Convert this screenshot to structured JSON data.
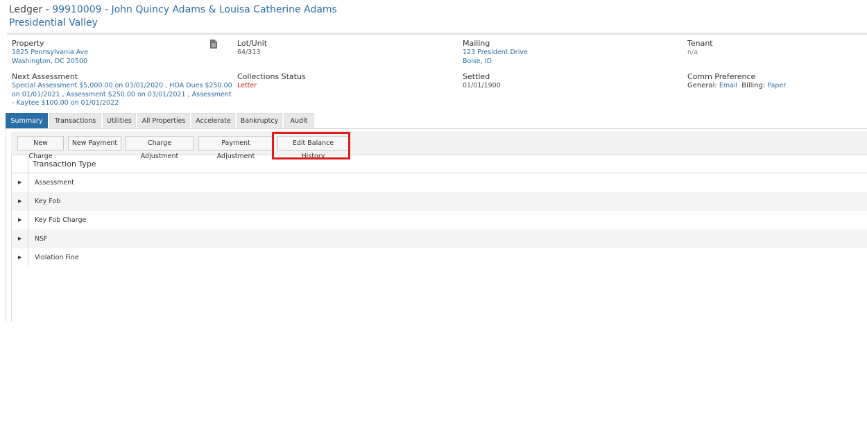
{
  "header": {
    "prefix": "Ledger - ",
    "account": "99910009 - John Quincy Adams & Louisa Catherine Adams",
    "community": "Presidential Valley"
  },
  "info": {
    "property": {
      "label": "Property",
      "line1": "1825 Pennsylvania Ave",
      "line2": "Washington, DC 20500"
    },
    "lot": {
      "label": "Lot/Unit",
      "value": "64/313"
    },
    "mailing": {
      "label": "Mailing",
      "line1": "123 President Drive",
      "line2": "Boise, ID"
    },
    "tenant": {
      "label": "Tenant",
      "value": "n/a"
    },
    "next_assessment": {
      "label": "Next Assessment",
      "line1": "Special Assessment $5,000.00 on 03/01/2020 , HOA Dues $250.00",
      "line2": "on 01/01/2021 , Assessment $250.00 on 03/01/2021 , Assessment",
      "line3": "- Kaytee $100.00 on 01/01/2022"
    },
    "collections": {
      "label": "Collections Status",
      "value": "Letter"
    },
    "settled": {
      "label": "Settled",
      "value": "01/01/1900"
    },
    "comm": {
      "label": "Comm Preference",
      "general_label": "General:",
      "general_value": "Email",
      "billing_label": "Billing:",
      "billing_value": "Paper"
    }
  },
  "tabs": [
    "Summary",
    "Transactions",
    "Utilities",
    "All Properties",
    "Accelerate",
    "Bankruptcy",
    "Audit"
  ],
  "toolbar": {
    "new_charge": "New Charge",
    "new_payment": "New Payment",
    "charge_adjustment": "Charge Adjustment",
    "payment_adjustment": "Payment Adjustment",
    "edit_balance_history": "Edit Balance History"
  },
  "grid": {
    "header": "Transaction Type",
    "rows": [
      "Assessment",
      "Key Fob",
      "Key Fob Charge",
      "NSF",
      "Violation Fine"
    ]
  },
  "colors": {
    "accent": "#2a6ea6",
    "highlight": "#e01a1a",
    "status_red": "#cc2222"
  }
}
